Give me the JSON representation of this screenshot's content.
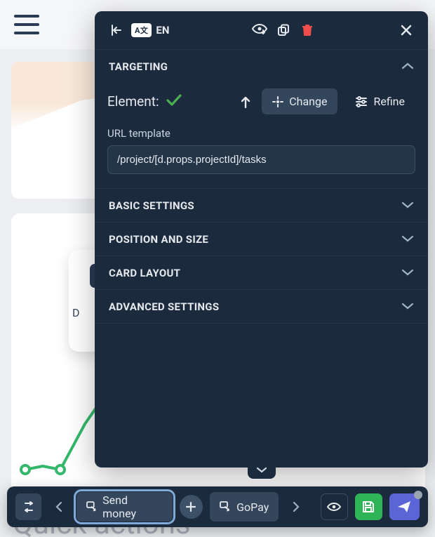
{
  "bg": {
    "mini_card_text": "D",
    "footer_text": "Quick actions"
  },
  "panel": {
    "lang_code": "EN",
    "lang_badge": "A文",
    "sections": {
      "targeting": "TARGETING",
      "basic": "BASIC SETTINGS",
      "position": "POSITION AND SIZE",
      "layout": "CARD LAYOUT",
      "advanced": "ADVANCED SETTINGS"
    },
    "targeting": {
      "element_label": "Element:",
      "change": "Change",
      "refine": "Refine",
      "url_label": "URL template",
      "url_value": "/project/[d.props.projectId]/tasks"
    }
  },
  "toolbar": {
    "chip1": "Send money",
    "chip2": "GoPay"
  }
}
